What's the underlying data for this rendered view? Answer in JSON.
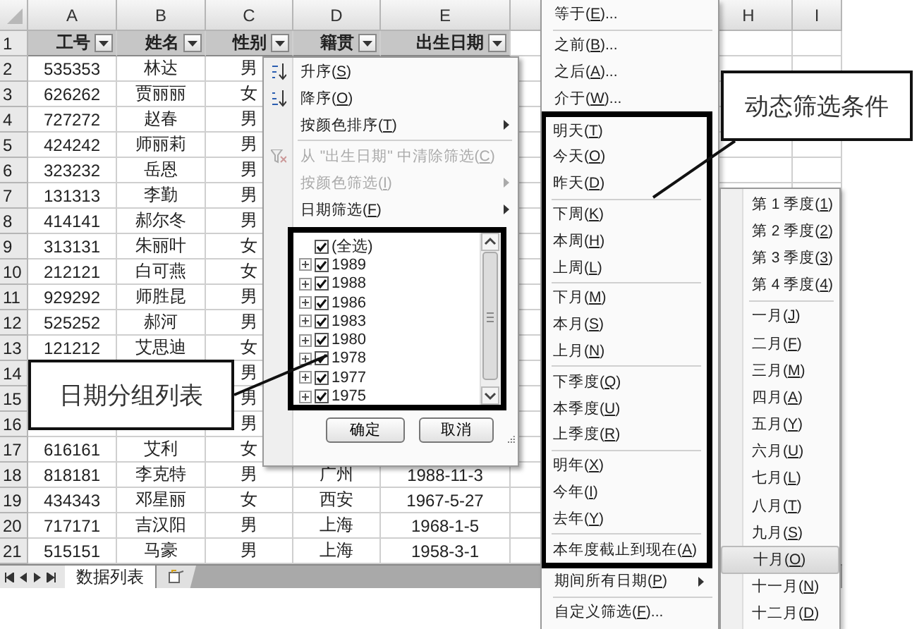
{
  "sheet": {
    "columns": [
      "A",
      "B",
      "C",
      "D",
      "E"
    ],
    "right_columns": [
      "H",
      "I"
    ],
    "header_row": {
      "number": "1",
      "cells": [
        "工号",
        "姓名",
        "性别",
        "籍贯",
        "出生日期"
      ]
    },
    "rows": [
      {
        "number": "2",
        "id_no": "535353",
        "name": "林达",
        "gender": "男"
      },
      {
        "number": "3",
        "id_no": "626262",
        "name": "贾丽丽",
        "gender": "女"
      },
      {
        "number": "4",
        "id_no": "727272",
        "name": "赵春",
        "gender": "男"
      },
      {
        "number": "5",
        "id_no": "424242",
        "name": "师丽莉",
        "gender": "男"
      },
      {
        "number": "6",
        "id_no": "323232",
        "name": "岳恩",
        "gender": "男"
      },
      {
        "number": "7",
        "id_no": "131313",
        "name": "李勤",
        "gender": "男"
      },
      {
        "number": "8",
        "id_no": "414141",
        "name": "郝尔冬",
        "gender": "男"
      },
      {
        "number": "9",
        "id_no": "313131",
        "name": "朱丽叶",
        "gender": "女"
      },
      {
        "number": "10",
        "id_no": "212121",
        "name": "白可燕",
        "gender": "女"
      },
      {
        "number": "11",
        "id_no": "929292",
        "name": "师胜昆",
        "gender": "男"
      },
      {
        "number": "12",
        "id_no": "525252",
        "name": "郝河",
        "gender": "男"
      },
      {
        "number": "13",
        "id_no": "121212",
        "name": "艾思迪",
        "gender": "女"
      },
      {
        "number": "14",
        "gender": "男"
      },
      {
        "number": "15",
        "gender": "男"
      },
      {
        "number": "16",
        "gender": "男"
      },
      {
        "number": "17",
        "id_no": "616161",
        "name": "艾利",
        "gender": "女"
      },
      {
        "number": "18",
        "id_no": "818181",
        "name": "李克特",
        "gender": "男",
        "origin": "广州",
        "birth_date": "1988-11-3"
      },
      {
        "number": "19",
        "id_no": "434343",
        "name": "邓星丽",
        "gender": "女",
        "origin": "西安",
        "birth_date": "1967-5-27"
      },
      {
        "number": "20",
        "id_no": "717171",
        "name": "吉汉阳",
        "gender": "男",
        "origin": "上海",
        "birth_date": "1968-1-5"
      },
      {
        "number": "21",
        "id_no": "515151",
        "name": "马豪",
        "gender": "男",
        "origin": "上海",
        "birth_date": "1958-3-1"
      }
    ],
    "sheet_tabs": [
      {
        "label": "数据列表",
        "selected": true
      }
    ]
  },
  "filter_menu": {
    "items": [
      {
        "kind": "sort_ascending",
        "label": "升序(S)",
        "disabled": false,
        "has_submenu": false
      },
      {
        "kind": "sort_descending",
        "label": "降序(O)",
        "disabled": false,
        "has_submenu": false
      },
      {
        "kind": "item",
        "label": "按颜色排序(T)",
        "disabled": false,
        "has_submenu": true
      },
      {
        "kind": "separator"
      },
      {
        "kind": "clear_filter",
        "label": "从 \"出生日期\" 中清除筛选(C)",
        "disabled": true,
        "has_submenu": false
      },
      {
        "kind": "item",
        "label": "按颜色筛选(I)",
        "disabled": true,
        "has_submenu": true
      },
      {
        "kind": "item",
        "label": "日期筛选(F)",
        "disabled": false,
        "has_submenu": true
      }
    ],
    "list": [
      {
        "label": "(全选)",
        "checked": true,
        "expandable": false
      },
      {
        "label": "1989",
        "checked": true,
        "expandable": true
      },
      {
        "label": "1988",
        "checked": true,
        "expandable": true
      },
      {
        "label": "1986",
        "checked": true,
        "expandable": true
      },
      {
        "label": "1983",
        "checked": true,
        "expandable": true
      },
      {
        "label": "1980",
        "checked": true,
        "expandable": true
      },
      {
        "label": "1978",
        "checked": true,
        "expandable": true
      },
      {
        "label": "1977",
        "checked": true,
        "expandable": true
      },
      {
        "label": "1975",
        "checked": true,
        "expandable": true
      }
    ],
    "buttons": [
      "确定",
      "取消"
    ]
  },
  "date_menu": {
    "groups": [
      {
        "framed": false,
        "items": [
          {
            "kind": "item",
            "label": "等于(E)...",
            "selected": false,
            "has_submenu": false
          },
          {
            "kind": "separator"
          },
          {
            "kind": "item",
            "label": "之前(B)...",
            "selected": false,
            "has_submenu": false
          },
          {
            "kind": "item",
            "label": "之后(A)...",
            "selected": false,
            "has_submenu": false
          },
          {
            "kind": "item",
            "label": "介于(W)...",
            "selected": false,
            "has_submenu": false
          }
        ]
      },
      {
        "framed": true,
        "items": [
          {
            "kind": "item",
            "label": "明天(T)",
            "selected": false,
            "has_submenu": false
          },
          {
            "kind": "item",
            "label": "今天(O)",
            "selected": false,
            "has_submenu": false
          },
          {
            "kind": "item",
            "label": "昨天(D)",
            "selected": false,
            "has_submenu": false
          },
          {
            "kind": "separator"
          },
          {
            "kind": "item",
            "label": "下周(K)",
            "selected": false,
            "has_submenu": false
          },
          {
            "kind": "item",
            "label": "本周(H)",
            "selected": false,
            "has_submenu": false
          },
          {
            "kind": "item",
            "label": "上周(L)",
            "selected": false,
            "has_submenu": false
          },
          {
            "kind": "separator"
          },
          {
            "kind": "item",
            "label": "下月(M)",
            "selected": false,
            "has_submenu": false
          },
          {
            "kind": "item",
            "label": "本月(S)",
            "selected": false,
            "has_submenu": false
          },
          {
            "kind": "item",
            "label": "上月(N)",
            "selected": false,
            "has_submenu": false
          },
          {
            "kind": "separator"
          },
          {
            "kind": "item",
            "label": "下季度(Q)",
            "selected": false,
            "has_submenu": false
          },
          {
            "kind": "item",
            "label": "本季度(U)",
            "selected": false,
            "has_submenu": false
          },
          {
            "kind": "item",
            "label": "上季度(R)",
            "selected": false,
            "has_submenu": false
          },
          {
            "kind": "separator"
          },
          {
            "kind": "item",
            "label": "明年(X)",
            "selected": false,
            "has_submenu": false
          },
          {
            "kind": "item",
            "label": "今年(I)",
            "selected": false,
            "has_submenu": false
          },
          {
            "kind": "item",
            "label": "去年(Y)",
            "selected": false,
            "has_submenu": false
          },
          {
            "kind": "separator"
          },
          {
            "kind": "item",
            "label": "本年度截止到现在(A)",
            "selected": false,
            "has_submenu": false
          }
        ]
      },
      {
        "framed": false,
        "items": [
          {
            "kind": "item",
            "label": "期间所有日期(P)",
            "selected": false,
            "has_submenu": true
          },
          {
            "kind": "separator"
          },
          {
            "kind": "item",
            "label": "自定义筛选(F)...",
            "selected": false,
            "has_submenu": false
          }
        ]
      }
    ]
  },
  "period_submenu": {
    "items": [
      {
        "kind": "item",
        "label": "第 1 季度(1)",
        "selected": false
      },
      {
        "kind": "item",
        "label": "第 2 季度(2)",
        "selected": false
      },
      {
        "kind": "item",
        "label": "第 3 季度(3)",
        "selected": false
      },
      {
        "kind": "item",
        "label": "第 4 季度(4)",
        "selected": false
      },
      {
        "kind": "separator"
      },
      {
        "kind": "item",
        "label": "一月(J)",
        "selected": false
      },
      {
        "kind": "item",
        "label": "二月(F)",
        "selected": false
      },
      {
        "kind": "item",
        "label": "三月(M)",
        "selected": false
      },
      {
        "kind": "item",
        "label": "四月(A)",
        "selected": false
      },
      {
        "kind": "item",
        "label": "五月(Y)",
        "selected": false
      },
      {
        "kind": "item",
        "label": "六月(U)",
        "selected": false
      },
      {
        "kind": "item",
        "label": "七月(L)",
        "selected": false
      },
      {
        "kind": "item",
        "label": "八月(T)",
        "selected": false
      },
      {
        "kind": "item",
        "label": "九月(S)",
        "selected": false
      },
      {
        "kind": "item",
        "label": "十月(O)",
        "selected": true
      },
      {
        "kind": "item",
        "label": "十一月(N)",
        "selected": false
      },
      {
        "kind": "item",
        "label": "十二月(D)",
        "selected": false
      }
    ]
  },
  "callouts": [
    {
      "text": "日期分组列表"
    },
    {
      "text": "动态筛选条件"
    }
  ]
}
